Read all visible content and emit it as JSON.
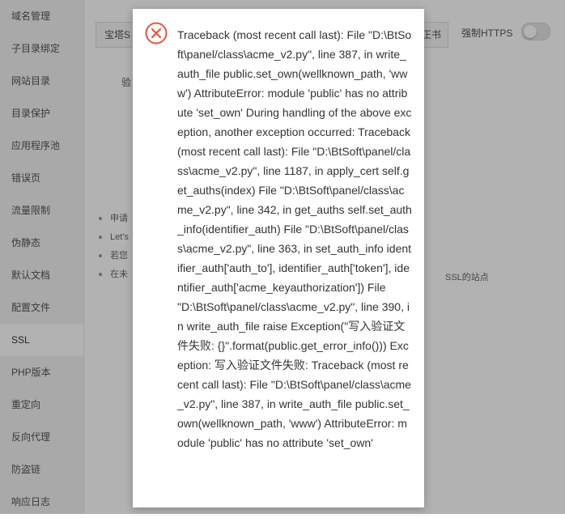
{
  "sidebar": {
    "items": [
      {
        "label": "域名管理"
      },
      {
        "label": "子目录绑定"
      },
      {
        "label": "网站目录"
      },
      {
        "label": "目录保护"
      },
      {
        "label": "应用程序池"
      },
      {
        "label": "错误页"
      },
      {
        "label": "流量限制"
      },
      {
        "label": "伪静态"
      },
      {
        "label": "默认文档"
      },
      {
        "label": "配置文件"
      },
      {
        "label": "SSL"
      },
      {
        "label": "PHP版本"
      },
      {
        "label": "重定向"
      },
      {
        "label": "反向代理"
      },
      {
        "label": "防盗链"
      },
      {
        "label": "响应日志"
      }
    ],
    "active_index": 10
  },
  "main": {
    "tab_first": "宝塔S",
    "tab_last": "正书",
    "force_https_label": "强制HTTPS",
    "verify_label": "验",
    "notes": [
      "申请",
      "Let's",
      "若您",
      "在未"
    ],
    "note_tail": "SSL的站点"
  },
  "dialog": {
    "icon": "error-circle-x-icon",
    "icon_color": "#e4573c",
    "message": "Traceback (most recent call last): File \"D:\\BtSoft\\panel/class\\acme_v2.py\", line 387, in write_auth_file public.set_own(wellknown_path, 'www') AttributeError: module 'public' has no attribute 'set_own' During handling of the above exception, another exception occurred: Traceback (most recent call last): File \"D:\\BtSoft\\panel/class\\acme_v2.py\", line 1187, in apply_cert self.get_auths(index) File \"D:\\BtSoft\\panel/class\\acme_v2.py\", line 342, in get_auths self.set_auth_info(identifier_auth) File \"D:\\BtSoft\\panel/class\\acme_v2.py\", line 363, in set_auth_info identifier_auth['auth_to'], identifier_auth['token'], identifier_auth['acme_keyauthorization']) File \"D:\\BtSoft\\panel/class\\acme_v2.py\", line 390, in write_auth_file raise Exception(\"写入验证文件失败: {}\".format(public.get_error_info())) Exception: 写入验证文件失败: Traceback (most recent call last): File \"D:\\BtSoft\\panel/class\\acme_v2.py\", line 387, in write_auth_file public.set_own(wellknown_path, 'www') AttributeError: module 'public' has no attribute 'set_own'"
  }
}
